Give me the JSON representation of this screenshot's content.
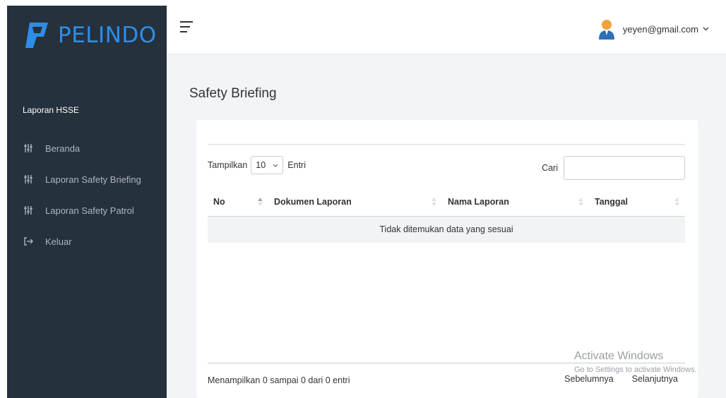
{
  "brand": {
    "name": "PELINDO",
    "color": "#2e8de6"
  },
  "sidebar": {
    "section_title": "Laporan HSSE",
    "items": [
      {
        "label": "Beranda",
        "icon": "sliders-icon"
      },
      {
        "label": "Laporan Safety Briefing",
        "icon": "sliders-icon"
      },
      {
        "label": "Laporan Safety Patrol",
        "icon": "sliders-icon"
      },
      {
        "label": "Keluar",
        "icon": "logout-icon"
      }
    ]
  },
  "header": {
    "user_email": "yeyen@gmail.com"
  },
  "page": {
    "title": "Safety Briefing"
  },
  "table_controls": {
    "show_label": "Tampilkan",
    "page_length": "10",
    "entries_label": "Entri",
    "search_label": "Cari",
    "search_value": ""
  },
  "table": {
    "columns": [
      "No",
      "Dokumen Laporan",
      "Nama Laporan",
      "Tanggal"
    ],
    "empty_message": "Tidak ditemukan data yang sesuai"
  },
  "footer": {
    "info": "Menampilkan 0 sampai 0 dari 0 entri",
    "prev_label": "Sebelumnya",
    "next_label": "Selanjutnya"
  },
  "watermark": {
    "title": "Activate Windows",
    "subtitle": "Go to Settings to activate Windows."
  },
  "colors": {
    "sidebar_bg": "#25313c",
    "content_bg": "#f3f4f7",
    "accent": "#2e8de6"
  }
}
